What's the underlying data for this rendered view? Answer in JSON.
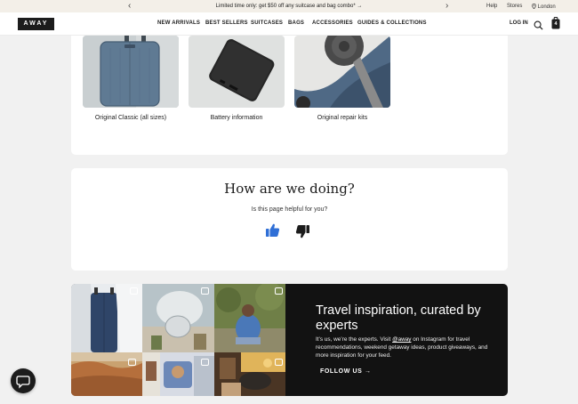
{
  "announcement": {
    "promo_text": "Limited time only: get $50 off any suitcase and bag combo* →",
    "help": "Help",
    "stores": "Stores",
    "location": "London"
  },
  "nav": {
    "logo": "AWAY",
    "items": [
      {
        "label": "NEW ARRIVALS"
      },
      {
        "label": "BEST SELLERS"
      },
      {
        "label": "SUITCASES"
      },
      {
        "label": "BAGS"
      },
      {
        "label": "ACCESSORIES"
      },
      {
        "label": "GUIDES & COLLECTIONS"
      }
    ],
    "login": "LOG IN",
    "cart_count": "4"
  },
  "resources": {
    "tiles": [
      {
        "label": "Original Classic (all sizes)"
      },
      {
        "label": "Battery information"
      },
      {
        "label": "Original repair kits"
      }
    ]
  },
  "feedback": {
    "heading": "How are we doing?",
    "question": "Is this page helpful for you?"
  },
  "instagram": {
    "title": "Travel inspiration, curated by experts",
    "body_before": "It’s us, we’re the experts. Visit ",
    "handle": "@away",
    "body_after": " on Instagram for travel recommendations, weekend getaway ideas, product giveaways, and more inspiration for your feed.",
    "cta": "FOLLOW US →"
  },
  "colors": {
    "page_bg": "#f1f1f1",
    "announce_bg": "#f3efe8",
    "thumb_up": "#2f6fd6",
    "thumb_down": "#1c1c1c",
    "promo_bg": "#121212"
  }
}
